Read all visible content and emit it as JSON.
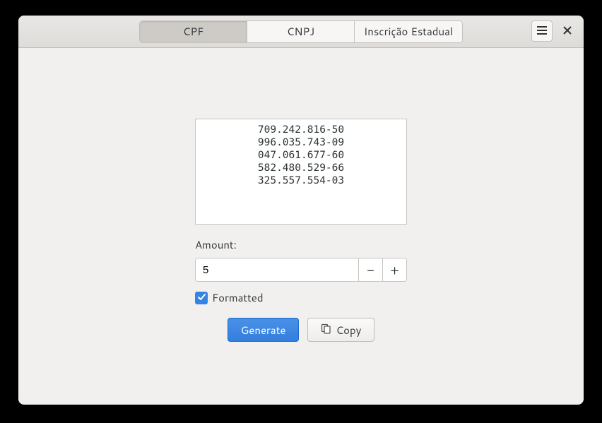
{
  "tabs": [
    {
      "label": "CPF",
      "active": true
    },
    {
      "label": "CNPJ",
      "active": false
    },
    {
      "label": "Inscrição Estadual",
      "active": false
    }
  ],
  "output_lines": [
    "709.242.816-50",
    "996.035.743-09",
    "047.061.677-60",
    "582.480.529-66",
    "325.557.554-03"
  ],
  "amount": {
    "label": "Amount:",
    "value": "5"
  },
  "formatted": {
    "label": "Formatted",
    "checked": true
  },
  "buttons": {
    "generate": "Generate",
    "copy": "Copy"
  }
}
